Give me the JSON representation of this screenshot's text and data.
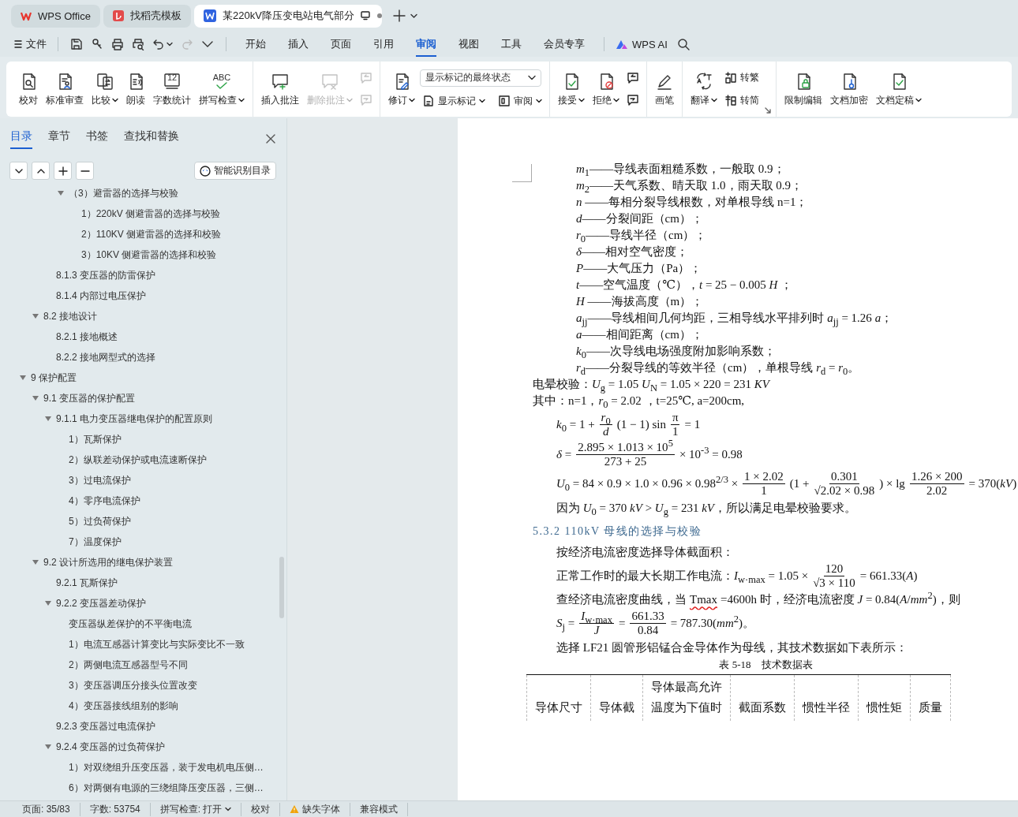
{
  "tabs": [
    {
      "kind": "home",
      "label": "WPS Office",
      "selected": false
    },
    {
      "kind": "template",
      "label": "找稻壳模板",
      "selected": false
    },
    {
      "kind": "doc",
      "label": "某220kV降压变电站电气部分",
      "selected": true
    }
  ],
  "menu": {
    "file": "文件",
    "tabs": [
      {
        "label": "开始",
        "selected": false
      },
      {
        "label": "插入",
        "selected": false
      },
      {
        "label": "页面",
        "selected": false
      },
      {
        "label": "引用",
        "selected": false
      },
      {
        "label": "审阅",
        "selected": true
      },
      {
        "label": "视图",
        "selected": false
      },
      {
        "label": "工具",
        "selected": false
      },
      {
        "label": "会员专享",
        "selected": false
      }
    ],
    "ai": "WPS AI"
  },
  "ribbon": {
    "groups": [
      [
        {
          "kind": "big",
          "label": "校对",
          "menu": false,
          "disabled": false
        },
        {
          "kind": "big",
          "label": "标准审查",
          "menu": false,
          "disabled": false
        },
        {
          "kind": "big",
          "label": "比较",
          "menu": true,
          "disabled": false
        },
        {
          "kind": "big",
          "label": "朗读",
          "menu": false,
          "disabled": false
        },
        {
          "kind": "big",
          "label": "字数统计",
          "menu": false,
          "disabled": false,
          "icon_text": "12"
        },
        {
          "kind": "big",
          "label": "拼写检查",
          "menu": true,
          "disabled": false,
          "icon_text": "ABC"
        }
      ],
      [
        {
          "kind": "big",
          "label": "插入批注",
          "menu": false,
          "disabled": false
        },
        {
          "kind": "big",
          "label": "删除批注",
          "menu": true,
          "disabled": true
        },
        {
          "kind": "icons",
          "buttons": [
            {
              "disabled": true
            },
            {
              "disabled": true
            }
          ]
        }
      ],
      [
        {
          "kind": "big",
          "label": "修订",
          "menu": true,
          "disabled": false
        },
        {
          "kind": "select",
          "value": "显示标记的最终状态",
          "buttons": [
            {
              "label": "显示标记",
              "menu": true
            },
            {
              "label": "审阅",
              "menu": true
            }
          ]
        }
      ],
      [
        {
          "kind": "big",
          "label": "接受",
          "menu": true,
          "disabled": false
        },
        {
          "kind": "big",
          "label": "拒绝",
          "menu": true,
          "disabled": false
        },
        {
          "kind": "icons",
          "buttons": [
            {
              "disabled": false
            },
            {
              "disabled": false
            }
          ]
        }
      ],
      [
        {
          "kind": "big",
          "label": "画笔",
          "menu": false,
          "disabled": false
        }
      ],
      [
        {
          "kind": "big",
          "label": "翻译",
          "menu": true,
          "disabled": false
        },
        {
          "kind": "small",
          "buttons": [
            {
              "label": "转繁",
              "menu": false
            },
            {
              "label": "转简",
              "menu": false
            }
          ]
        }
      ],
      [
        {
          "kind": "big",
          "label": "限制编辑",
          "menu": false,
          "disabled": false
        },
        {
          "kind": "big",
          "label": "文档加密",
          "menu": false,
          "disabled": false
        },
        {
          "kind": "big",
          "label": "文档定稿",
          "menu": true,
          "disabled": false
        }
      ]
    ]
  },
  "sidebar": {
    "tabs": [
      {
        "label": "目录",
        "selected": true
      },
      {
        "label": "章节",
        "selected": false
      },
      {
        "label": "书签",
        "selected": false
      },
      {
        "label": "查找和替换",
        "selected": false
      }
    ],
    "smart_button": "智能识别目录",
    "toc": [
      {
        "children": [
          {
            "children": [
              {
                "children": [
                  {
                    "label": "（3）避雷器的选择与校验",
                    "expanded": true,
                    "children": [
                      {
                        "label": "1）220kV 侧避雷器的选择与校验"
                      },
                      {
                        "label": "2）110KV 侧避雷器的选择和校验"
                      },
                      {
                        "label": "3）10KV 侧避雷器的选择和校验"
                      }
                    ]
                  }
                ]
              },
              {
                "label": "8.1.3  变压器的防雷保护"
              },
              {
                "label": "8.1.4 内部过电压保护"
              }
            ]
          },
          {
            "label": "8.2  接地设计",
            "expanded": true,
            "children": [
              {
                "label": "8.2.1  接地概述"
              },
              {
                "label": "8.2.2  接地网型式的选择"
              }
            ]
          }
        ]
      },
      {
        "label": "9  保护配置",
        "expanded": true,
        "children": [
          {
            "label": "9.1  变压器的保护配置",
            "expanded": true,
            "children": [
              {
                "label": "9.1.1 电力变压器继电保护的配置原则",
                "expanded": true,
                "children": [
                  {
                    "label": "1）瓦斯保护"
                  },
                  {
                    "label": "2）纵联差动保护或电流速断保护"
                  },
                  {
                    "label": "3）过电流保护"
                  },
                  {
                    "label": "4）零序电流保护"
                  },
                  {
                    "label": "5）过负荷保护"
                  },
                  {
                    "label": "7）温度保护"
                  }
                ]
              }
            ]
          },
          {
            "label": "9.2 设计所选用的继电保护装置",
            "expanded": true,
            "children": [
              {
                "label": "9.2.1 瓦斯保护"
              },
              {
                "label": "9.2.2 变压器差动保护",
                "expanded": true,
                "children": [
                  {
                    "label": "变压器纵差保护的不平衡电流"
                  },
                  {
                    "label": "1）电流互感器计算变比与实际变比不一致"
                  },
                  {
                    "label": "2）两侧电流互感器型号不同"
                  },
                  {
                    "label": "3）变压器调压分接头位置改变"
                  },
                  {
                    "label": "4）变压器接线组别的影响"
                  }
                ]
              },
              {
                "label": "9.2.3  变压器过电流保护"
              },
              {
                "label": "9.2.4 变压器的过负荷保护",
                "expanded": true,
                "children": [
                  {
                    "label": "1）对双绕组升压变压器，装于发电机电压侧…"
                  },
                  {
                    "label": "6）对两侧有电源的三绕组降压变压器，三侧…"
                  }
                ]
              }
            ]
          }
        ]
      }
    ]
  },
  "document": {
    "lines": [
      {
        "kind": "def",
        "parts": [
          {
            "kind": "text",
            "text": "*m*$_{1}$——导线表面粗糙系数，一般取 0.9；"
          }
        ]
      },
      {
        "kind": "def",
        "parts": [
          {
            "kind": "text",
            "text": "*m*$_{2}$——天气系数、晴天取 1.0，雨天取 0.9；"
          }
        ]
      },
      {
        "kind": "def",
        "parts": [
          {
            "kind": "text",
            "text": "*n* ——每相分裂导线根数，对单根导线 n=1；"
          }
        ]
      },
      {
        "kind": "def",
        "parts": [
          {
            "kind": "text",
            "text": "*d*——分裂间距（cm）；"
          }
        ]
      },
      {
        "kind": "def",
        "parts": [
          {
            "kind": "text",
            "text": "*r*$_{0}$——导线半径（cm）；"
          }
        ]
      },
      {
        "kind": "def",
        "parts": [
          {
            "kind": "text",
            "text": "*δ*——相对空气密度；"
          }
        ]
      },
      {
        "kind": "def",
        "parts": [
          {
            "kind": "text",
            "text": "*P*——大气压力（Pa）；"
          }
        ]
      },
      {
        "kind": "def",
        "parts": [
          {
            "kind": "text",
            "text": "*t*——空气温度（℃），*t* = 25 − 0.005 *H* ；"
          }
        ]
      },
      {
        "kind": "def",
        "parts": [
          {
            "kind": "text",
            "text": "*H* ——海拔高度（m）；"
          }
        ]
      },
      {
        "kind": "def",
        "parts": [
          {
            "kind": "text",
            "text": "*a*$_{jj}$——导线相间几何均距，三相导线水平排列时 *a*$_{jj}$ = 1.26 *a*；"
          }
        ]
      },
      {
        "kind": "def",
        "parts": [
          {
            "kind": "text",
            "text": "*a*——相间距离（cm）；"
          }
        ]
      },
      {
        "kind": "def",
        "parts": [
          {
            "kind": "text",
            "text": "*k*$_{0}$——次导线电场强度附加影响系数；"
          }
        ]
      },
      {
        "kind": "def",
        "parts": [
          {
            "kind": "text",
            "text": "*r*$_{d}$——分裂导线的等效半径（cm），单根导线 *r*$_{d}$ = *r*$_{0}$。"
          }
        ]
      },
      {
        "kind": "text",
        "parts": [
          {
            "kind": "text",
            "text": "电晕校验：*U*$_{g}$ = 1.05 *U*$_{N}$ = 1.05 × 220 = 231 *KV*"
          }
        ]
      },
      {
        "kind": "text",
        "parts": [
          {
            "kind": "text",
            "text": "其中：n=1，*r*$_{0}$ = 2.02 ，t=25℃, a=200cm,"
          }
        ]
      },
      {
        "kind": "indent",
        "parts": [
          {
            "kind": "text",
            "text": "*k*$_{0}$ = 1 +"
          },
          {
            "kind": "frac",
            "num": "*r*$_{0}$",
            "den": "*d*"
          },
          {
            "kind": "text",
            "text": "(1 − 1) sin"
          },
          {
            "kind": "frac",
            "num": "π",
            "den": "1"
          },
          {
            "kind": "text",
            "text": "= 1"
          }
        ]
      },
      {
        "kind": "indent",
        "parts": [
          {
            "kind": "text",
            "text": "*δ* ="
          },
          {
            "kind": "frac",
            "num": "2.895 × 1.013 × 10$^{5}$",
            "den": "273 + 25"
          },
          {
            "kind": "text",
            "text": "× 10$^{-3}$ = 0.98"
          }
        ]
      },
      {
        "kind": "indent",
        "parts": [
          {
            "kind": "text",
            "text": "*U*$_{0}$ = 84 × 0.9 × 1.0 × 0.96 × 0.98$^{2/3}$ ×"
          },
          {
            "kind": "frac",
            "num": "1 × 2.02",
            "den": "1"
          },
          {
            "kind": "text",
            "text": "(1 +"
          },
          {
            "kind": "frac",
            "num": "0.301",
            "den": "√2.02 × 0.98"
          },
          {
            "kind": "text",
            "text": ") × lg"
          },
          {
            "kind": "frac",
            "num": "1.26 × 200",
            "den": "2.02"
          },
          {
            "kind": "text",
            "text": "= 370(*kV*)"
          }
        ]
      },
      {
        "kind": "indent",
        "parts": [
          {
            "kind": "text",
            "text": "因为 *U*$_{0}$ = 370 *kV* > *U*$_{g}$ = 231 *kV*，所以满足电晕校验要求。"
          }
        ]
      },
      {
        "kind": "heading",
        "parts": [
          {
            "kind": "text",
            "text": "5.3.2 110kV 母线的选择与校验"
          }
        ]
      },
      {
        "kind": "indent",
        "parts": [
          {
            "kind": "text",
            "text": "按经济电流密度选择导体截面积："
          }
        ]
      },
      {
        "kind": "indent",
        "parts": [
          {
            "kind": "text",
            "text": "正常工作时的最大长期工作电流：*I*$_{w·max}$ = 1.05 ×"
          },
          {
            "kind": "frac",
            "num": "120",
            "den": "√3 × 110"
          },
          {
            "kind": "text",
            "text": "= 661.33(*A*)"
          }
        ]
      },
      {
        "kind": "indent",
        "parts": [
          {
            "kind": "text",
            "text": " 查经济电流密度曲线，当"
          },
          {
            "kind": "misspelled",
            "text": "Tmax"
          },
          {
            "kind": "text",
            "text": "=4600h 时，经济电流密度 *J* = 0.84(*A*/*mm*$^{2}$)，则"
          }
        ]
      },
      {
        "kind": "indent",
        "parts": [
          {
            "kind": "text",
            "text": "*S*$_{j}$ ="
          },
          {
            "kind": "frac",
            "num": "*I*$_{w·max}$",
            "den": "*J*"
          },
          {
            "kind": "text",
            "text": "="
          },
          {
            "kind": "frac",
            "num": "661.33",
            "den": "0.84"
          },
          {
            "kind": "text",
            "text": "= 787.30(*mm*$^{2}$)。"
          }
        ]
      },
      {
        "kind": "indent",
        "parts": [
          {
            "kind": "text",
            "text": "选择 LF21 圆管形铝锰合金导体作为母线，其技术数据如下表所示："
          }
        ]
      },
      {
        "kind": "caption",
        "parts": [
          {
            "kind": "text",
            "text": "表 5-18　技术数据表"
          }
        ]
      }
    ],
    "table": {
      "columns": [
        [
          "导体尺寸"
        ],
        [
          "导体截"
        ],
        [
          "导体最高允许",
          "温度为下值时"
        ],
        [
          "截面系数"
        ],
        [
          "惯性半径"
        ],
        [
          "惯性矩"
        ],
        [
          "质量"
        ]
      ]
    }
  },
  "status_bar": [
    {
      "kind": "text",
      "text": "页面: 35/83"
    },
    {
      "kind": "text",
      "text": "字数: 53754"
    },
    {
      "kind": "menu",
      "text": "拼写检查: 打开"
    },
    {
      "kind": "text",
      "text": "校对"
    },
    {
      "kind": "warning",
      "text": "缺失字体"
    },
    {
      "kind": "text",
      "text": "兼容模式"
    }
  ]
}
